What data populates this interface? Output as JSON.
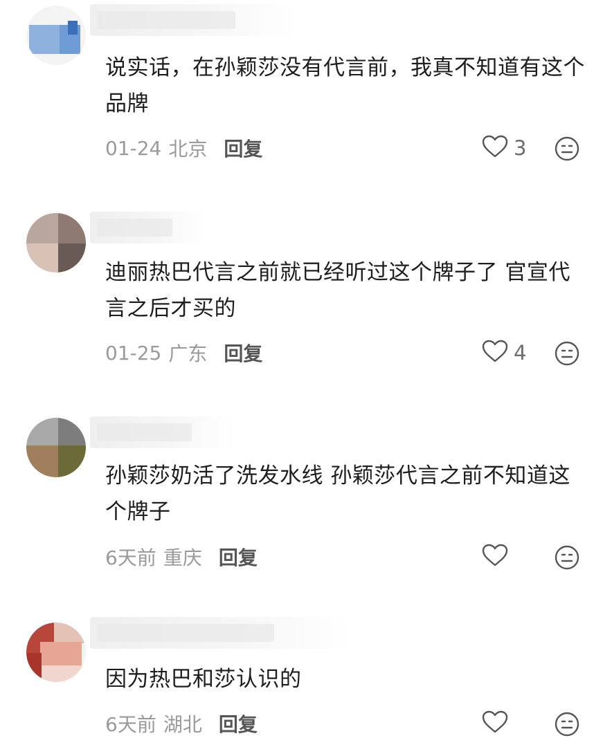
{
  "comments": [
    {
      "text": "说实话，在孙颖莎没有代言前，我真不知道有这个品牌",
      "date": "01-24",
      "location": "北京",
      "reply_label": "回复",
      "likes": "3"
    },
    {
      "text": "迪丽热巴代言之前就已经听过这个牌子了 官宣代言之后才买的",
      "date": "01-25",
      "location": "广东",
      "reply_label": "回复",
      "likes": "4"
    },
    {
      "text": "孙颖莎奶活了洗发水线 孙颖莎代言之前不知道这个牌子",
      "date": "6天前",
      "location": "重庆",
      "reply_label": "回复",
      "likes": ""
    },
    {
      "text": "因为热巴和莎认识的",
      "date": "6天前",
      "location": "湖北",
      "reply_label": "回复",
      "likes": ""
    }
  ],
  "icons": {
    "like": "heart-outline-icon",
    "reaction": "neutral-face-icon"
  },
  "colors": {
    "text": "#1e1e1e",
    "meta": "#9a9a9a",
    "reply": "#555555",
    "icon": "#555555"
  }
}
